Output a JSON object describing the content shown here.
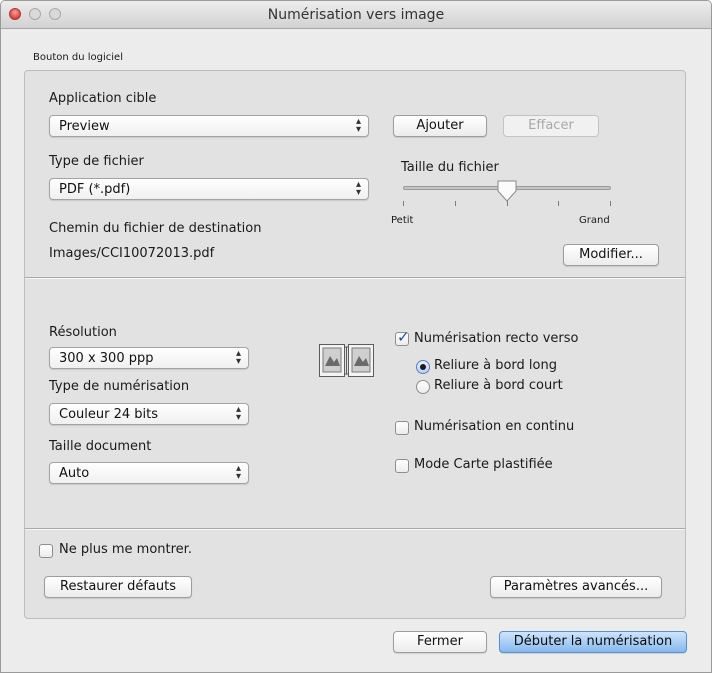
{
  "window": {
    "title": "Numérisation vers image"
  },
  "software_button": {
    "label": "Bouton du logiciel"
  },
  "target_app": {
    "label": "Application cible",
    "value": "Preview",
    "add_label": "Ajouter",
    "delete_label": "Effacer"
  },
  "file_type": {
    "label": "Type de fichier",
    "value": "PDF (*.pdf)"
  },
  "file_size": {
    "label": "Taille du fichier",
    "min_label": "Petit",
    "max_label": "Grand",
    "level": 0.5
  },
  "destination": {
    "label": "Chemin du fichier de destination",
    "path": "Images/CCI10072013.pdf",
    "modify_label": "Modifier..."
  },
  "resolution": {
    "label": "Résolution",
    "value": "300 x 300 ppp"
  },
  "scan_type": {
    "label": "Type de numérisation",
    "value": "Couleur 24 bits"
  },
  "doc_size": {
    "label": "Taille document",
    "value": "Auto"
  },
  "duplex": {
    "label": "Numérisation recto verso",
    "checked": true,
    "long_edge_label": "Reliure à bord long",
    "short_edge_label": "Reliure à bord court",
    "selected": "long_edge"
  },
  "continuous": {
    "label": "Numérisation en continu",
    "checked": false
  },
  "plastic_card": {
    "label": "Mode Carte plastifiée",
    "checked": false
  },
  "dont_show": {
    "label": "Ne plus me montrer.",
    "checked": false
  },
  "buttons": {
    "restore": "Restaurer défauts",
    "advanced": "Paramètres avancés...",
    "close": "Fermer",
    "start": "Débuter la numérisation"
  },
  "colors": {
    "default_button": "#86b9ef",
    "close_light": "#d9433a",
    "check_mark": "#1d4d9a"
  },
  "icons": {
    "duplex": "duplex-page-icon",
    "popup": "up-down-arrows-icon"
  }
}
